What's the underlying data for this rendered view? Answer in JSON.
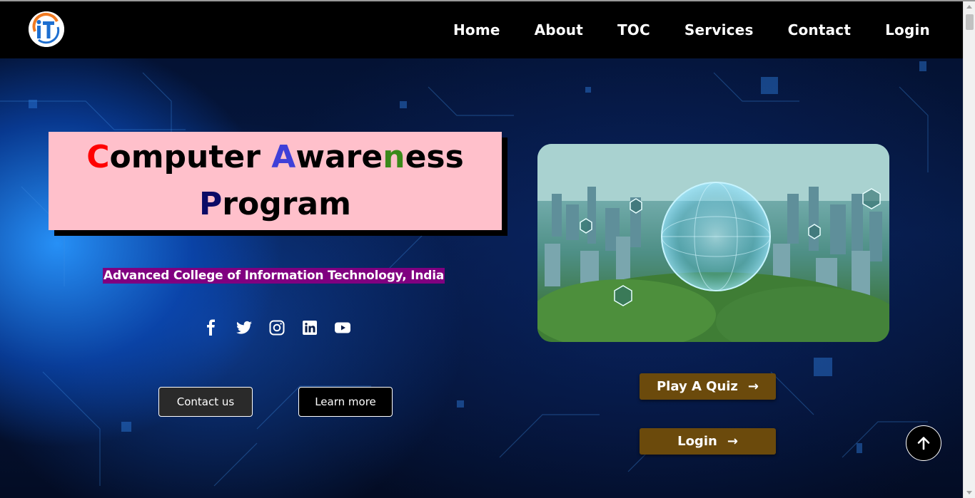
{
  "nav": {
    "logo_text": "iT",
    "links": [
      "Home",
      "About",
      "TOC",
      "Services",
      "Contact",
      "Login"
    ]
  },
  "hero": {
    "title": {
      "line1": [
        {
          "text": "C",
          "accent": "#ff0000"
        },
        {
          "text": "omputer ",
          "accent": null
        },
        {
          "text": "A",
          "accent": "#3f3fd8"
        },
        {
          "text": "ware",
          "accent": null
        },
        {
          "text": "n",
          "accent": "#3a8a1a"
        },
        {
          "text": "ess",
          "accent": null
        }
      ],
      "line2": [
        {
          "text": "P",
          "accent": "#0b0b66"
        },
        {
          "text": "rogram",
          "accent": null
        }
      ]
    },
    "subtitle": "Advanced College of Information Technology, India",
    "socials": [
      "facebook-icon",
      "twitter-icon",
      "instagram-icon",
      "linkedin-icon",
      "youtube-icon"
    ],
    "contact_label": "Contact us",
    "learn_label": "Learn more",
    "quiz_label": "Play A Quiz",
    "login_label": "Login",
    "arrow": "→"
  },
  "colors": {
    "title_box": "#ffc0cb",
    "subtitle_bg": "#800080",
    "brown_button": "#6b4a0c",
    "navbar": "#000000"
  }
}
